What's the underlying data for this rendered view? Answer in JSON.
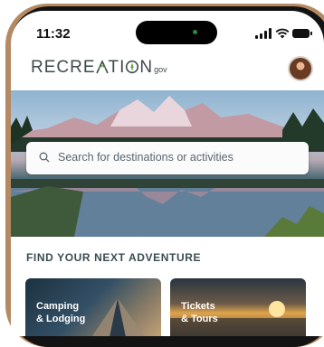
{
  "status_bar": {
    "time": "11:32"
  },
  "header": {
    "logo_part1": "RECRE",
    "logo_part2": "TI",
    "logo_part3": "N",
    "logo_gov": "gov"
  },
  "search": {
    "placeholder": "Search for destinations or activities"
  },
  "section": {
    "title": "FIND YOUR NEXT ADVENTURE"
  },
  "cards": [
    {
      "label": "Camping\n& Lodging"
    },
    {
      "label": "Tickets\n& Tours"
    }
  ],
  "colors": {
    "frame": "#b58a63",
    "text_dark": "#3b4c52"
  }
}
